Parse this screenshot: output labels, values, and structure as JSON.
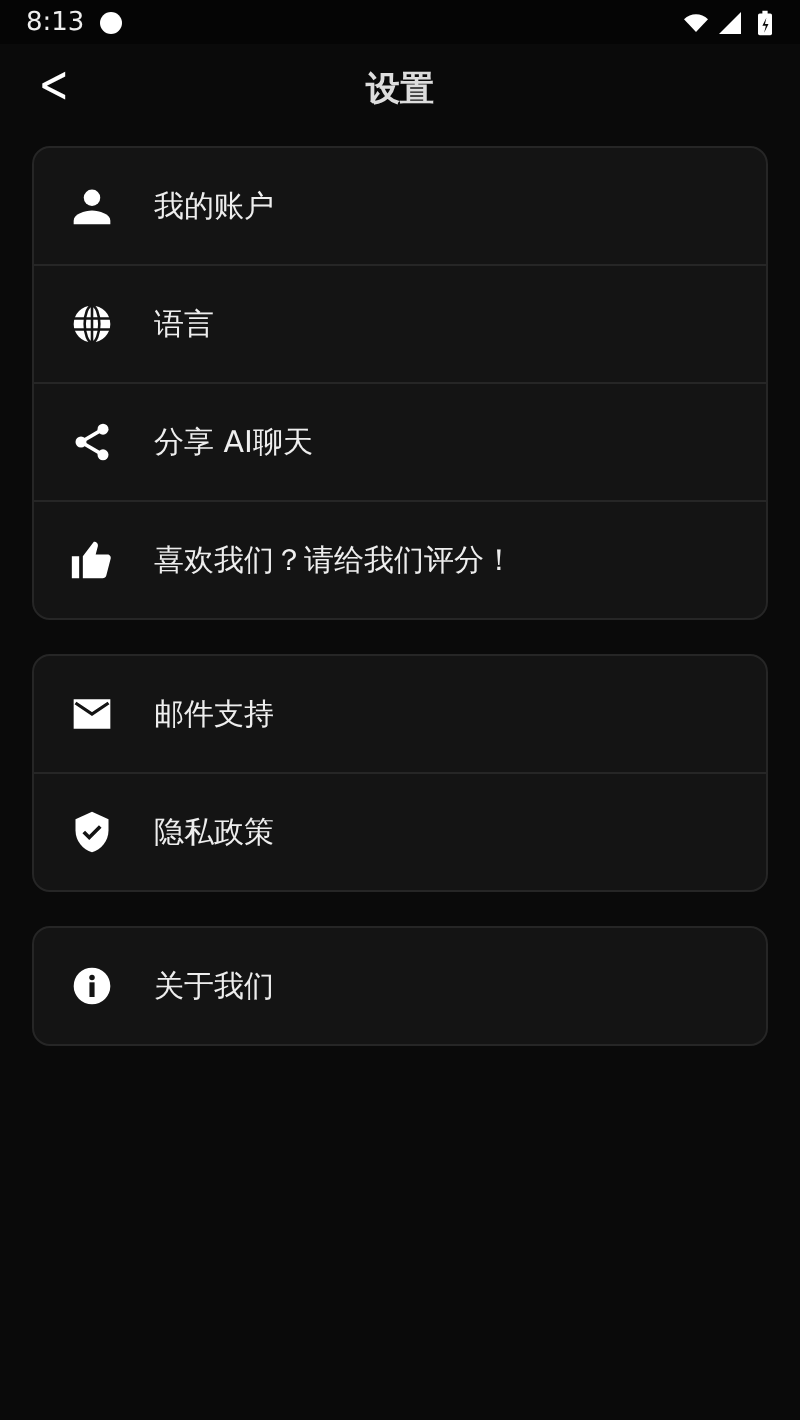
{
  "status_bar": {
    "time": "8:13"
  },
  "header": {
    "back": "<",
    "title": "设置"
  },
  "groups": [
    {
      "items": [
        {
          "label": "我的账户"
        },
        {
          "label": "语言"
        },
        {
          "label": "分享 AI聊天"
        },
        {
          "label": "喜欢我们？请给我们评分！"
        }
      ]
    },
    {
      "items": [
        {
          "label": "邮件支持"
        },
        {
          "label": "隐私政策"
        }
      ]
    },
    {
      "items": [
        {
          "label": "关于我们"
        }
      ]
    }
  ]
}
